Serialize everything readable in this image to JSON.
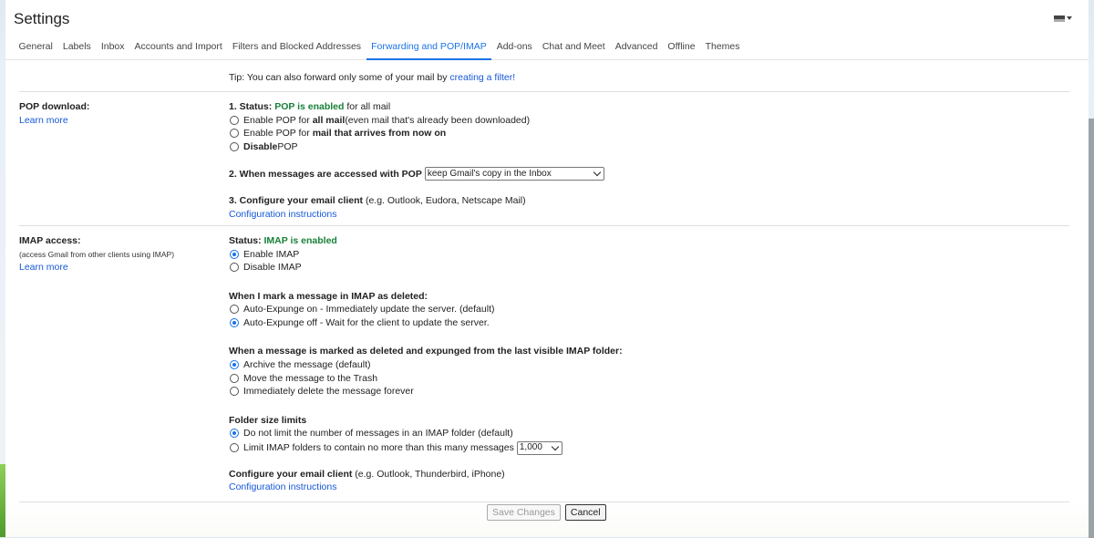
{
  "title": "Settings",
  "tabs": [
    {
      "label": "General"
    },
    {
      "label": "Labels"
    },
    {
      "label": "Inbox"
    },
    {
      "label": "Accounts and Import"
    },
    {
      "label": "Filters and Blocked Addresses"
    },
    {
      "label": "Forwarding and POP/IMAP",
      "active": true
    },
    {
      "label": "Add-ons"
    },
    {
      "label": "Chat and Meet"
    },
    {
      "label": "Advanced"
    },
    {
      "label": "Offline"
    },
    {
      "label": "Themes"
    }
  ],
  "tip": {
    "text": "Tip: You can also forward only some of your mail by ",
    "link": "creating a filter!"
  },
  "pop": {
    "label": "POP download:",
    "learn_more": "Learn more",
    "status_prefix": "1. Status: ",
    "status_value": "POP is enabled",
    "status_suffix": " for all mail",
    "opt1_pre": "Enable POP for ",
    "opt1_bold": "all mail",
    "opt1_post": " (even mail that's already been downloaded)",
    "opt2_pre": "Enable POP for ",
    "opt2_bold": "mail that arrives from now on",
    "opt3_bold": "Disable",
    "opt3_post": " POP",
    "access_label": "2. When messages are accessed with POP",
    "access_select": "keep Gmail's copy in the Inbox",
    "configure_label": "3. Configure your email client",
    "configure_hint": " (e.g. Outlook, Eudora, Netscape Mail)",
    "configure_link": "Configuration instructions"
  },
  "imap": {
    "label": "IMAP access:",
    "sublabel": "(access Gmail from other clients using IMAP)",
    "learn_more": "Learn more",
    "status_prefix": "Status: ",
    "status_value": "IMAP is enabled",
    "enable": "Enable IMAP",
    "disable": "Disable IMAP",
    "deleted_heading": "When I mark a message in IMAP as deleted:",
    "expunge_on": "Auto-Expunge on - Immediately update the server. (default)",
    "expunge_off": "Auto-Expunge off - Wait for the client to update the server.",
    "expunged_heading": "When a message is marked as deleted and expunged from the last visible IMAP folder:",
    "archive": "Archive the message (default)",
    "trash": "Move the message to the Trash",
    "delete_forever": "Immediately delete the message forever",
    "folder_heading": "Folder size limits",
    "no_limit": "Do not limit the number of messages in an IMAP folder (default)",
    "limit": "Limit IMAP folders to contain no more than this many messages",
    "limit_select": "1,000",
    "configure_label": "Configure your email client",
    "configure_hint": " (e.g. Outlook, Thunderbird, iPhone)",
    "configure_link": "Configuration instructions"
  },
  "buttons": {
    "save": "Save Changes",
    "cancel": "Cancel"
  },
  "colors": {
    "accent": "#1a73e8",
    "link": "#1558d6",
    "enabled_green": "#188038"
  }
}
